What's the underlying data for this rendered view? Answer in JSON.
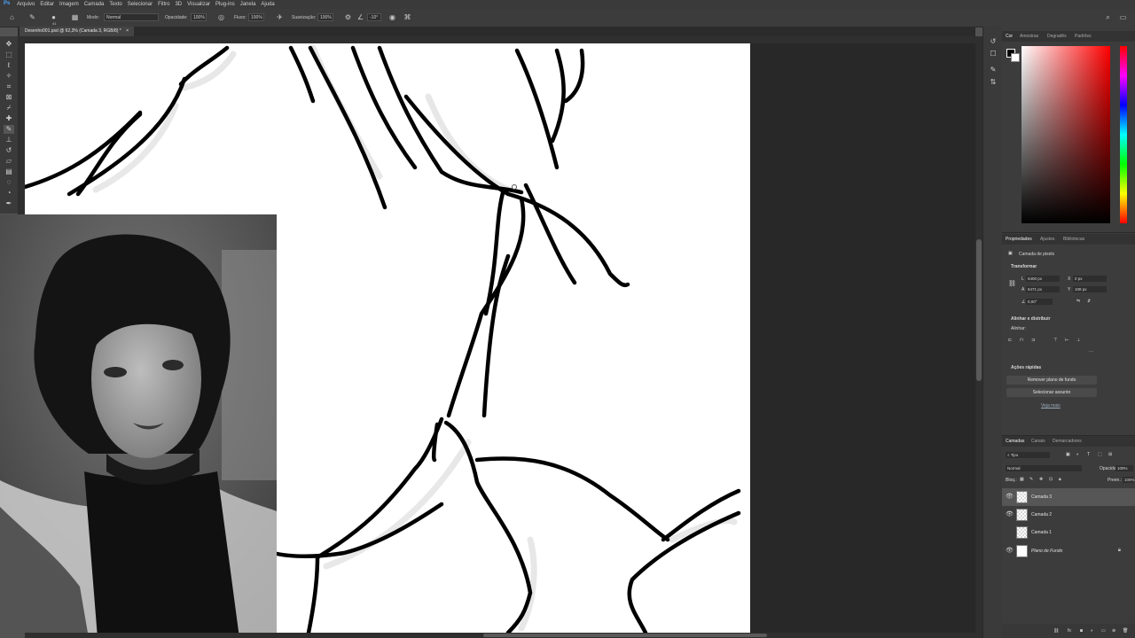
{
  "menu": [
    "Arquivo",
    "Editar",
    "Imagem",
    "Camada",
    "Texto",
    "Selecionar",
    "Filtro",
    "3D",
    "Visualizar",
    "Plug-ins",
    "Janela",
    "Ajuda"
  ],
  "options": {
    "brush_size": "41",
    "mode_label": "Modo:",
    "mode_value": "Normal",
    "opacity_label": "Opacidade:",
    "opacity_value": "100%",
    "flow_label": "Fluxo:",
    "flow_value": "100%",
    "smoothing_label": "Suavização:",
    "smoothing_value": "100%",
    "angle_value": "-10°"
  },
  "document": {
    "tab_title": "Desenho001.psd @ 62,3% (Camada 3, RGB/8) *"
  },
  "color_panel": {
    "tabs": [
      "Cor",
      "Amostras",
      "Degradês",
      "Padrões"
    ],
    "hue_color": "#ff0000"
  },
  "properties": {
    "tabs": [
      "Propriedades",
      "Ajustes",
      "Bibliotecas"
    ],
    "layer_kind": "Camada de pixels",
    "transform_title": "Transformar",
    "w_label": "L",
    "w_value": "5400 px",
    "h_label": "A",
    "h_value": "6471 px",
    "x_label": "X",
    "x_value": "0 px",
    "y_label": "Y",
    "y_value": "108 px",
    "angle_value": "0,00°",
    "align_title": "Alinhar e distribuir",
    "align_sub": "Alinhar:",
    "quick_title": "Ações rápidas",
    "remove_bg": "Remover plano de fundo",
    "select_subject": "Selecionar assunto",
    "see_more": "Veja mais"
  },
  "layers_panel": {
    "tabs": [
      "Camadas",
      "Canais",
      "Demarcadores"
    ],
    "filter_label": "Tipo",
    "blend_mode": "Normal",
    "opacity_label": "Opacidade:",
    "opacity_value": "100%",
    "lock_label": "Bloq.:",
    "fill_label": "Preen.:",
    "fill_value": "100%",
    "layers": [
      {
        "name": "Camada 3",
        "visible": true,
        "selected": true
      },
      {
        "name": "Camada 2",
        "visible": true,
        "selected": false
      },
      {
        "name": "Camada 1",
        "visible": false,
        "selected": false
      },
      {
        "name": "Plano de Fundo",
        "visible": true,
        "selected": false
      }
    ]
  }
}
